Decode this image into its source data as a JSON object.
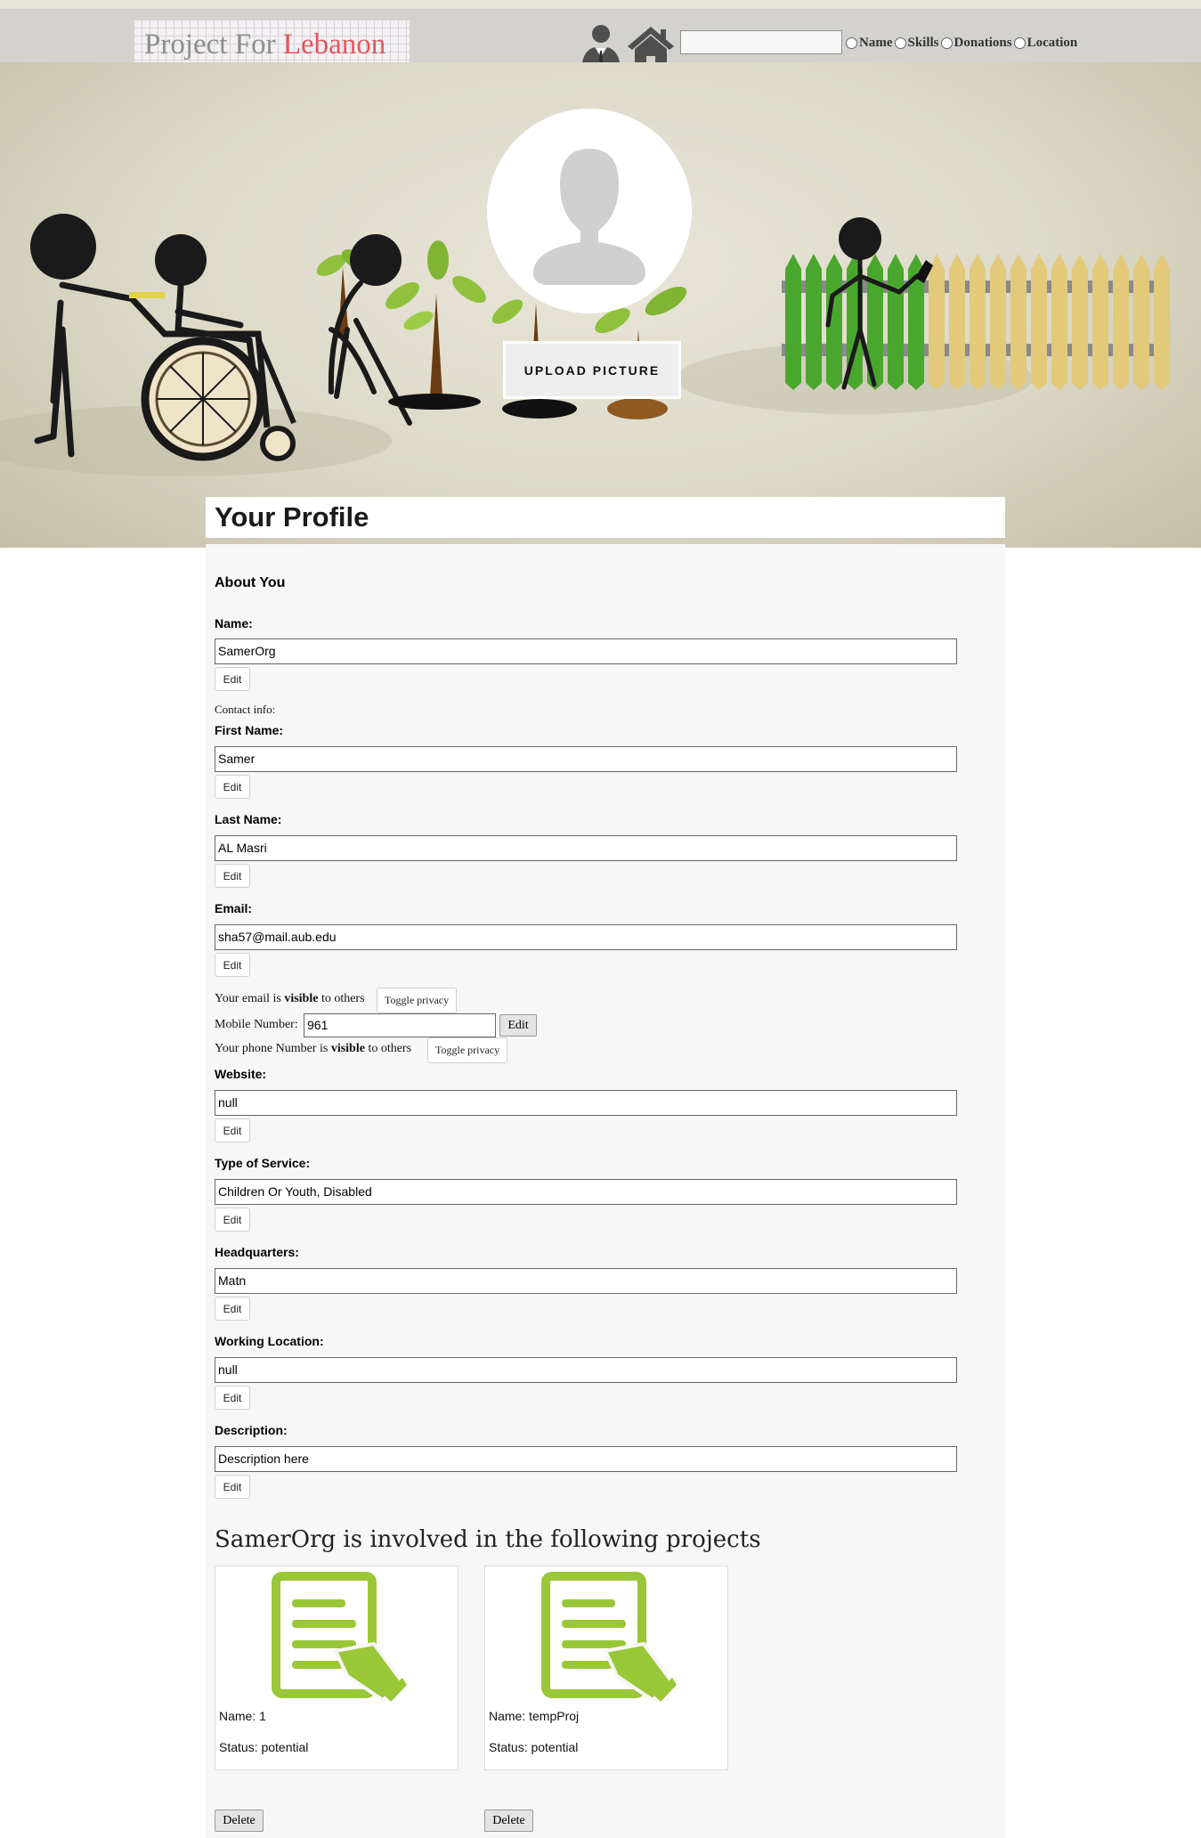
{
  "header": {
    "logo": {
      "part1": "Project For ",
      "part2": "Lebanon"
    },
    "search": {
      "value": "",
      "placeholder": ""
    },
    "search_options": [
      "Name",
      "Skills",
      "Donations",
      "Location"
    ]
  },
  "hero": {
    "upload_label": "UPLOAD PICTURE"
  },
  "profile": {
    "title": "Your Profile",
    "about_heading": "About You",
    "name_label": "Name:",
    "name_value": "SamerOrg",
    "contact_info_label": "Contact info:",
    "first_name_label": "First Name:",
    "first_name_value": "Samer",
    "last_name_label": "Last Name:",
    "last_name_value": "AL Masri",
    "email_label": "Email:",
    "email_value": "sha57@mail.aub.edu",
    "email_privacy": {
      "prefix": "Your email is ",
      "status": "visible",
      "suffix": " to others",
      "button": "Toggle privacy"
    },
    "mobile_label": "Mobile Number:",
    "mobile_value": "961",
    "mobile_edit": "Edit",
    "phone_privacy": {
      "prefix": "Your phone Number is ",
      "status": "visible",
      "suffix": " to others",
      "button": "Toggle privacy"
    },
    "website_label": "Website:",
    "website_value": "null",
    "service_label": "Type of Service:",
    "service_value": "Children Or Youth, Disabled",
    "hq_label": "Headquarters:",
    "hq_value": "Matn",
    "working_label": "Working Location:",
    "working_value": "null",
    "description_label": "Description:",
    "description_value": "Description here",
    "edit_label": "Edit"
  },
  "projects": {
    "heading": "SamerOrg is involved in the following projects",
    "items": [
      {
        "name": "Name: 1",
        "status": "Status: potential",
        "delete": "Delete"
      },
      {
        "name": "Name: tempProj",
        "status": "Status: potential",
        "delete": "Delete"
      }
    ]
  },
  "colors": {
    "navbar": "#d3d2ce",
    "logo_accent": "#e2575e",
    "project_icon": "#9ac737",
    "fence_green": "#4aa72d",
    "fence_yellow": "#e3c97a",
    "panel_bg": "#f7f7f7"
  }
}
